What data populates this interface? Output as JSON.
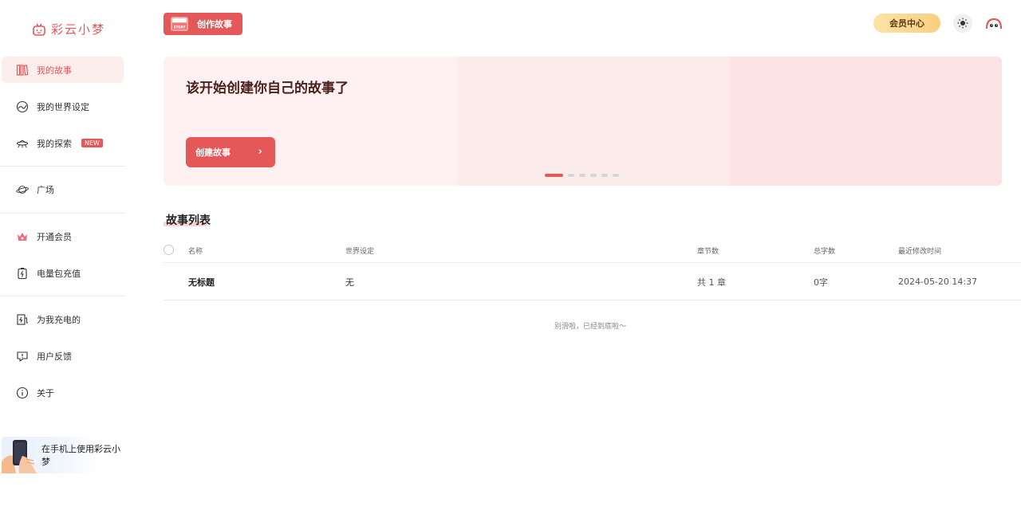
{
  "brand": {
    "name": "彩云小梦",
    "color": "#e5585a"
  },
  "header": {
    "create_label": "创作故事",
    "create_icon_text": "STORY",
    "vip_label": "会员中心"
  },
  "sidebar": {
    "items": [
      {
        "label": "我的故事",
        "icon": "books-icon",
        "active": true
      },
      {
        "label": "我的世界设定",
        "icon": "globe-icon"
      },
      {
        "label": "我的探索",
        "icon": "ufo-icon",
        "badge": "NEW"
      },
      {
        "label": "广场",
        "icon": "planet-icon"
      },
      {
        "label": "开通会员",
        "icon": "crown-icon"
      },
      {
        "label": "电量包充值",
        "icon": "battery-icon"
      },
      {
        "label": "为我充电的",
        "icon": "charge-icon"
      },
      {
        "label": "用户反馈",
        "icon": "feedback-icon"
      },
      {
        "label": "关于",
        "icon": "info-icon"
      }
    ],
    "mobile_promo": "在手机上使用彩云小梦"
  },
  "banner": {
    "title": "该开始创建你自己的故事了",
    "button_label": "创建故事",
    "slides_count": 6,
    "active_slide": 0
  },
  "story_list": {
    "title": "故事列表",
    "columns": [
      "名称",
      "世界设定",
      "章节数",
      "总字数",
      "最近修改时间"
    ],
    "rows": [
      {
        "name": "无标题",
        "world": "无",
        "chapters": "共 1 章",
        "words": "0字",
        "modified": "2024-05-20 14:37"
      }
    ],
    "end_text": "别滑啦，已经到底啦～"
  }
}
